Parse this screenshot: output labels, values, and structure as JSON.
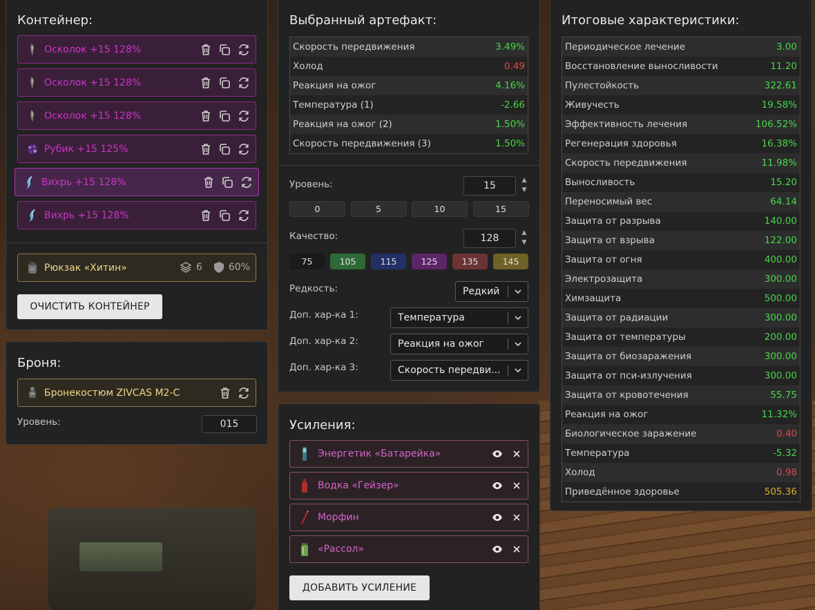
{
  "container": {
    "title": "Контейнер:",
    "artifacts": [
      {
        "label": "Осколок +15 128%"
      },
      {
        "label": "Осколок +15 128%"
      },
      {
        "label": "Осколок +15 128%"
      },
      {
        "label": "Рубик +15 125%"
      },
      {
        "label": "Вихрь +15 128%"
      },
      {
        "label": "Вихрь +15 128%"
      }
    ],
    "backpack": {
      "label": "Рюкзак «Хитин»",
      "slots": "6",
      "protection": "60%"
    },
    "clear_button": "ОЧИСТИТЬ КОНТЕЙНЕР"
  },
  "armor": {
    "title": "Броня:",
    "item": "Бронекостюм ZIVCAS M2-C",
    "level_label": "Уровень:",
    "level_value": "015"
  },
  "selected": {
    "title": "Выбранный артефакт:",
    "stats": [
      {
        "name": "Скорость передвижения",
        "value": "3.49%",
        "color": "green"
      },
      {
        "name": "Холод",
        "value": "0.49",
        "color": "red"
      },
      {
        "name": "Реакция на ожог",
        "value": "4.16%",
        "color": "green"
      },
      {
        "name": "Температура (1)",
        "value": "-2.66",
        "color": "green"
      },
      {
        "name": "Реакция на ожог (2)",
        "value": "1.50%",
        "color": "green"
      },
      {
        "name": "Скорость передвижения (3)",
        "value": "1.50%",
        "color": "green"
      }
    ],
    "level_label": "Уровень:",
    "level_value": "15",
    "level_presets": [
      "0",
      "5",
      "10",
      "15"
    ],
    "quality_label": "Качество:",
    "quality_value": "128",
    "quality_presets": [
      {
        "label": "75",
        "color": "#1a1a1a"
      },
      {
        "label": "105",
        "color": "#2f6a36"
      },
      {
        "label": "115",
        "color": "#223066"
      },
      {
        "label": "125",
        "color": "#5c2568"
      },
      {
        "label": "135",
        "color": "#6b3434"
      },
      {
        "label": "145",
        "color": "#6e6226"
      }
    ],
    "rarity_label": "Редкость:",
    "rarity_value": "Редкий",
    "extra1_label": "Доп. хар-ка 1:",
    "extra1_value": "Температура",
    "extra2_label": "Доп. хар-ка 2:",
    "extra2_value": "Реакция на ожог",
    "extra3_label": "Доп. хар-ка 3:",
    "extra3_value": "Скорость передви..."
  },
  "boosts": {
    "title": "Усиления:",
    "items": [
      {
        "label": "Энергетик «Батарейка»"
      },
      {
        "label": "Водка «Гейзер»"
      },
      {
        "label": "Морфин"
      },
      {
        "label": "«Рассол»"
      }
    ],
    "add_button": "ДОБАВИТЬ УСИЛЕНИЕ"
  },
  "totals": {
    "title": "Итоговые характеристики:",
    "stats": [
      {
        "name": "Периодическое лечение",
        "value": "3.00",
        "color": "green"
      },
      {
        "name": "Восстановление выносливости",
        "value": "11.20",
        "color": "green"
      },
      {
        "name": "Пулестойкость",
        "value": "322.61",
        "color": "green"
      },
      {
        "name": "Живучесть",
        "value": "19.58%",
        "color": "green"
      },
      {
        "name": "Эффективность лечения",
        "value": "106.52%",
        "color": "green"
      },
      {
        "name": "Регенерация здоровья",
        "value": "16.38%",
        "color": "green"
      },
      {
        "name": "Скорость передвижения",
        "value": "11.98%",
        "color": "green"
      },
      {
        "name": "Выносливость",
        "value": "15.20",
        "color": "green"
      },
      {
        "name": "Переносимый вес",
        "value": "64.14",
        "color": "green"
      },
      {
        "name": "Защита от разрыва",
        "value": "140.00",
        "color": "green"
      },
      {
        "name": "Защита от взрыва",
        "value": "122.00",
        "color": "green"
      },
      {
        "name": "Защита от огня",
        "value": "400.00",
        "color": "green"
      },
      {
        "name": "Электрозащита",
        "value": "300.00",
        "color": "green"
      },
      {
        "name": "Химзащита",
        "value": "500.00",
        "color": "green"
      },
      {
        "name": "Защита от радиации",
        "value": "300.00",
        "color": "green"
      },
      {
        "name": "Защита от температуры",
        "value": "200.00",
        "color": "green"
      },
      {
        "name": "Защита от биозаражения",
        "value": "300.00",
        "color": "green"
      },
      {
        "name": "Защита от пси-излучения",
        "value": "300.00",
        "color": "green"
      },
      {
        "name": "Защита от кровотечения",
        "value": "55.75",
        "color": "green"
      },
      {
        "name": "Реакция на ожог",
        "value": "11.32%",
        "color": "green"
      },
      {
        "name": "Биологическое заражение",
        "value": "0.40",
        "color": "red"
      },
      {
        "name": "Температура",
        "value": "-5.32",
        "color": "green"
      },
      {
        "name": "Холод",
        "value": "0.98",
        "color": "red"
      },
      {
        "name": "Приведённое здоровье",
        "value": "505.36",
        "color": "yellow"
      }
    ]
  }
}
